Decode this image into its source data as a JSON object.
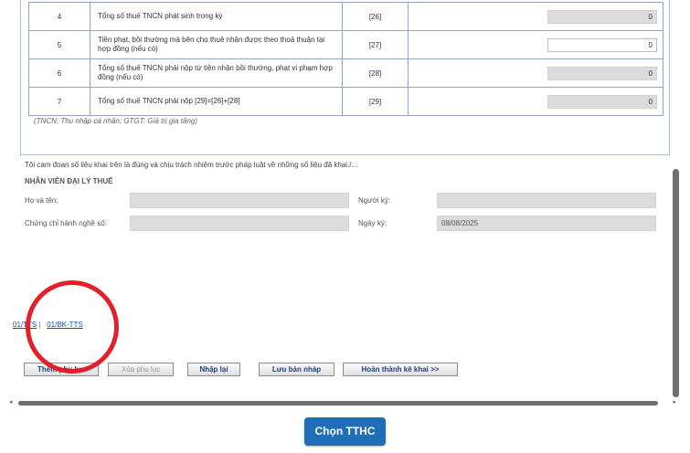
{
  "table": {
    "rows": [
      {
        "num": "4",
        "desc": "Tổng số thuế TNCN phát sinh trong kỳ",
        "code": "[26]",
        "value": "0",
        "editable": false
      },
      {
        "num": "5",
        "desc": "Tiền phạt, bồi thường mà bên cho thuê nhận được theo thoả thuận tại hợp đồng (nếu có)",
        "code": "[27]",
        "value": "0",
        "editable": true
      },
      {
        "num": "6",
        "desc": "Tổng số thuế TNCN phải nộp từ tiền nhận bồi thường, phạt vi phạm hợp đồng (nếu có)",
        "code": "[28]",
        "value": "0",
        "editable": false
      },
      {
        "num": "7",
        "desc": "Tổng số thuế TNCN phải nộp [29]=[26]+[28]",
        "code": "[29]",
        "value": "0",
        "editable": false
      }
    ],
    "note": "(TNCN: Thu nhập cá nhân; GTGT: Giá trị gia tăng)"
  },
  "declaration": "Tôi cam đoan số liệu khai trên là đúng và chịu trách nhiệm trước pháp luật về những số liệu đã khai./...",
  "agent": {
    "title": "NHÂN VIÊN ĐẠI LÝ THUẾ",
    "name_label": "Họ và tên:",
    "name_value": "",
    "cert_label": "Chứng chỉ hành nghề số:",
    "cert_value": "",
    "signer_label": "Người ký:",
    "signer_value": "",
    "sign_date_label": "Ngày ký:",
    "sign_date_value": "08/08/2025"
  },
  "tabs": {
    "tab1": "01/TTS",
    "separator": "|",
    "tab2": "01/BK-TTS"
  },
  "buttons": {
    "add_appendix": "Thêm phụ lục",
    "delete_appendix": "Xóa phụ lục",
    "reenter": "Nhập lại",
    "save_draft": "Lưu bản nháp",
    "complete": "Hoàn thành kê khai >>"
  },
  "submit_label": "Chọn TTHC",
  "colors": {
    "accent": "#1e6fb8",
    "highlight_circle": "#e3202a",
    "link": "#1f4fa8",
    "readonly_field": "#dcdcdc"
  }
}
